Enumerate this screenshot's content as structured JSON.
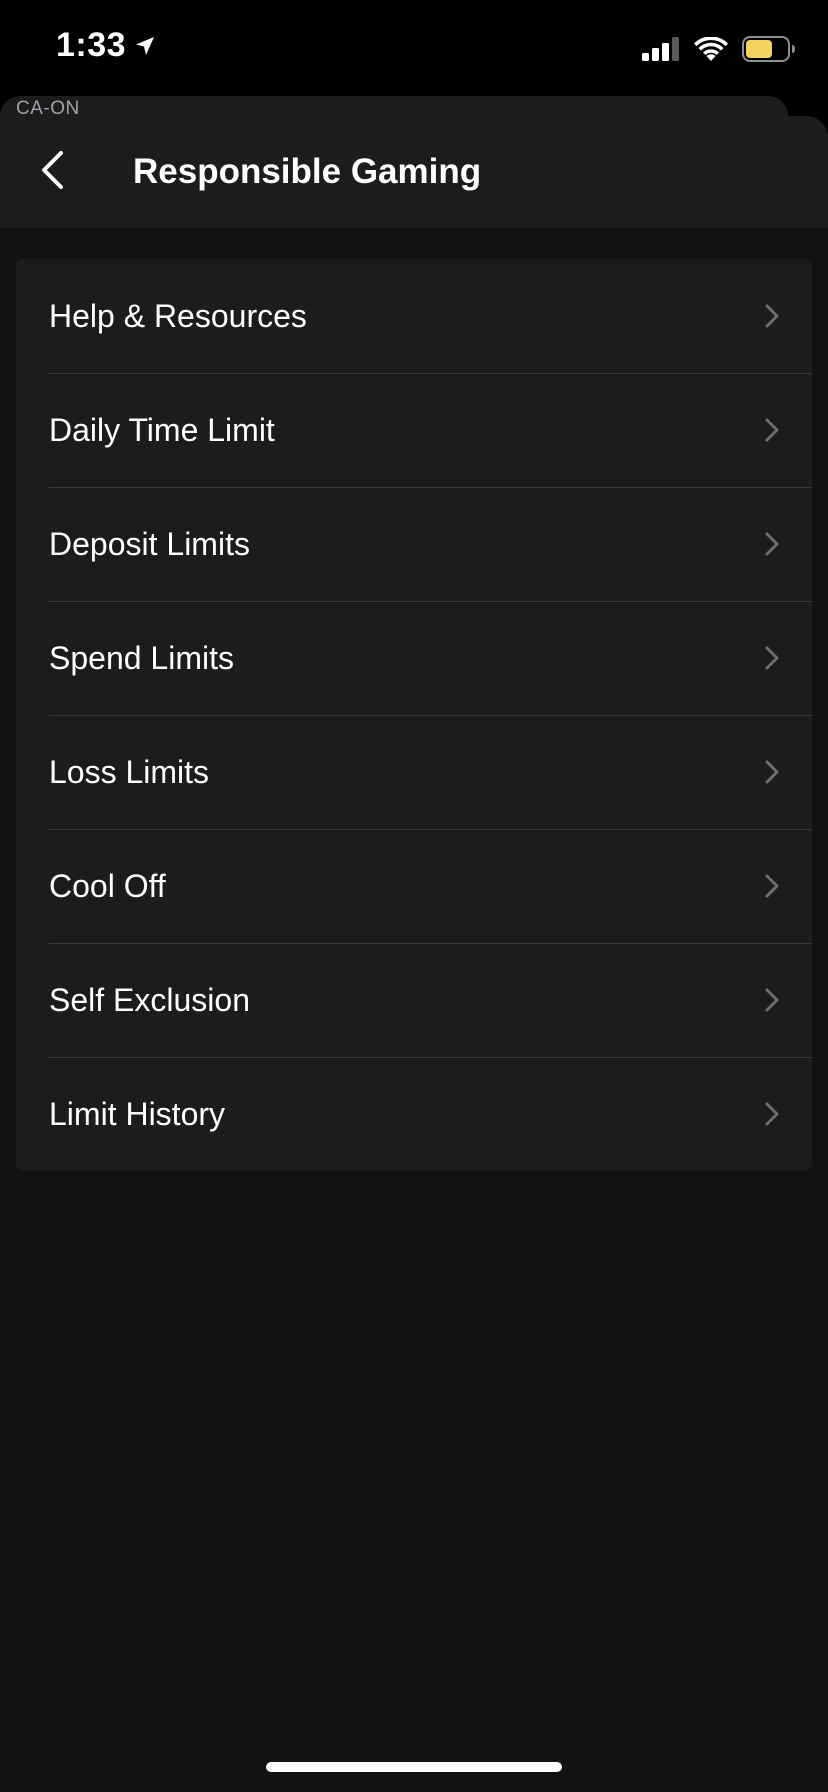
{
  "status_bar": {
    "time": "1:33",
    "location_icon": "location-arrow-icon",
    "signal_icon": "cellular-signal-icon",
    "wifi_icon": "wifi-icon",
    "battery_icon": "battery-icon",
    "battery_color": "#f4d35e",
    "battery_level": 0.45
  },
  "region": "CA-ON",
  "header": {
    "title": "Responsible Gaming",
    "back_icon": "chevron-left-icon"
  },
  "menu": {
    "items": [
      {
        "label": "Help & Resources"
      },
      {
        "label": "Daily Time Limit"
      },
      {
        "label": "Deposit Limits"
      },
      {
        "label": "Spend Limits"
      },
      {
        "label": "Loss Limits"
      },
      {
        "label": "Cool Off"
      },
      {
        "label": "Self Exclusion"
      },
      {
        "label": "Limit History"
      }
    ],
    "chevron_icon": "chevron-right-icon"
  },
  "colors": {
    "background": "#121212",
    "card": "#1c1c1e",
    "divider": "#38383a",
    "text": "#ffffff",
    "chevron": "#6e6e73"
  }
}
